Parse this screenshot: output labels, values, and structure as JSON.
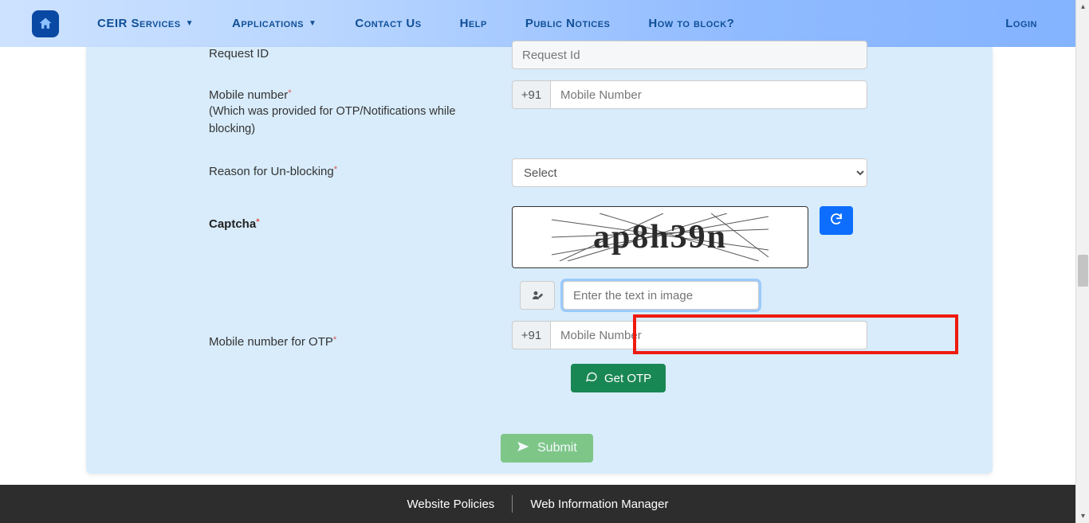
{
  "nav": {
    "items": [
      {
        "label": "CEIR Services",
        "has_chevron": true
      },
      {
        "label": "Applications",
        "has_chevron": true
      },
      {
        "label": "Contact Us",
        "has_chevron": false
      },
      {
        "label": "Help",
        "has_chevron": false
      },
      {
        "label": "Public Notices",
        "has_chevron": false
      },
      {
        "label": "How to block?",
        "has_chevron": false
      }
    ],
    "login": "Login"
  },
  "form": {
    "request_id": {
      "label": "Request ID",
      "placeholder": "Request Id",
      "value": ""
    },
    "mobile": {
      "label": "Mobile number",
      "hint": "(Which was provided for OTP/Notifications while blocking)",
      "prefix": "+91",
      "placeholder": "Mobile Number",
      "value": ""
    },
    "reason": {
      "label": "Reason for Un-blocking",
      "selected": "Select"
    },
    "captcha": {
      "label": "Captcha",
      "image_text": "ap8h39n",
      "entry_placeholder": "Enter the text in image",
      "entry_value": ""
    },
    "otp_mobile": {
      "label": "Mobile number for OTP",
      "prefix": "+91",
      "placeholder": "Mobile Number",
      "value": ""
    },
    "get_otp_label": "Get OTP",
    "submit_label": "Submit"
  },
  "footer": {
    "links": [
      "Website Policies",
      "Web Information Manager"
    ]
  },
  "colors": {
    "accent_blue": "#0d6efd",
    "nav_text": "#0f4f97",
    "success": "#198754",
    "highlight_red": "#ef1a0f"
  }
}
